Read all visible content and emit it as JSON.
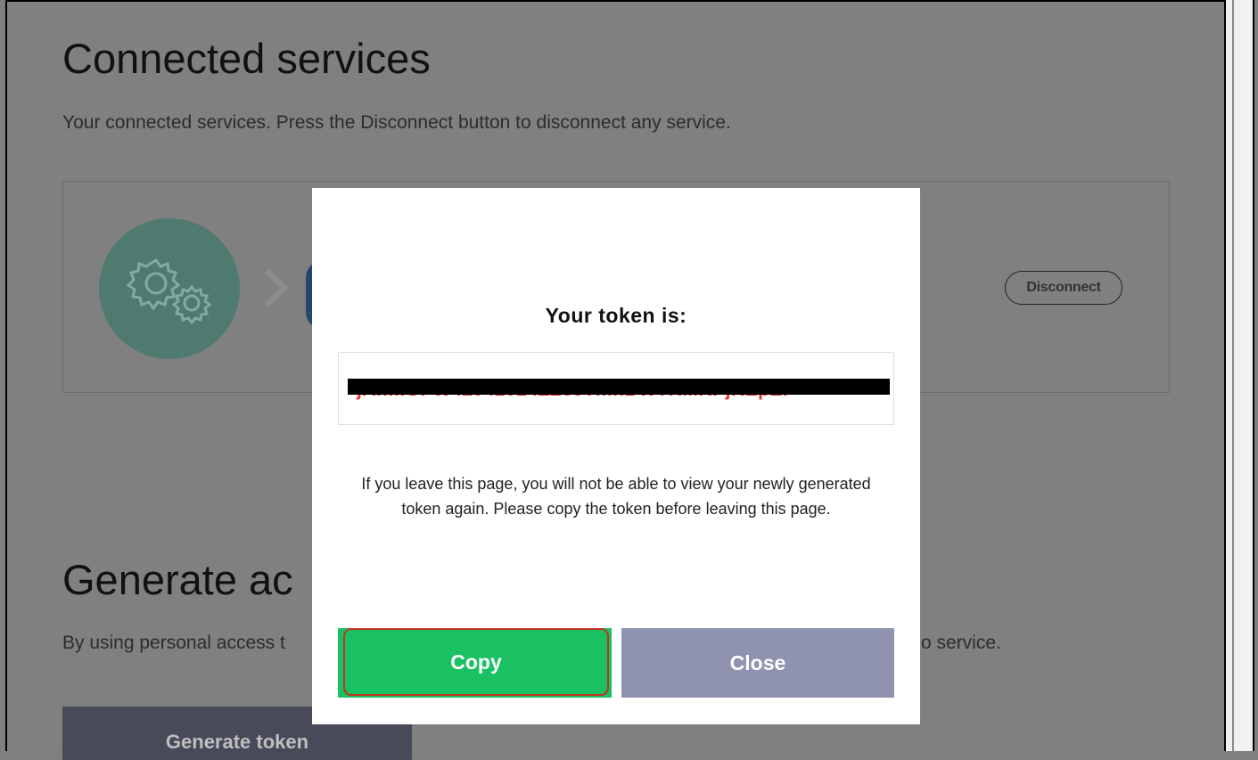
{
  "connected": {
    "title": "Connected services",
    "description": "Your connected services. Press the Disconnect button to disconnect any service.",
    "card": {
      "icon": "gears-icon",
      "disconnect_label": "Disconnect"
    }
  },
  "generate": {
    "title_visible": "Generate ac",
    "desc_left_visible": "By using personal access t",
    "desc_right_visible": "o service.",
    "button_label": "Generate token"
  },
  "modal": {
    "title": "Your token is:",
    "token_visible": "jAhmGPW42942024ZZ35TmnBWTRMRPjREpEP",
    "warning": "If you leave this page, you will not be able to view your newly generated token again. Please copy the token before leaving this page.",
    "copy_label": "Copy",
    "close_label": "Close"
  },
  "colors": {
    "overlay": "#808080",
    "copy": "#1ac163",
    "close": "#8f93af",
    "token": "#e8322c",
    "highlight": "#c0341e"
  }
}
